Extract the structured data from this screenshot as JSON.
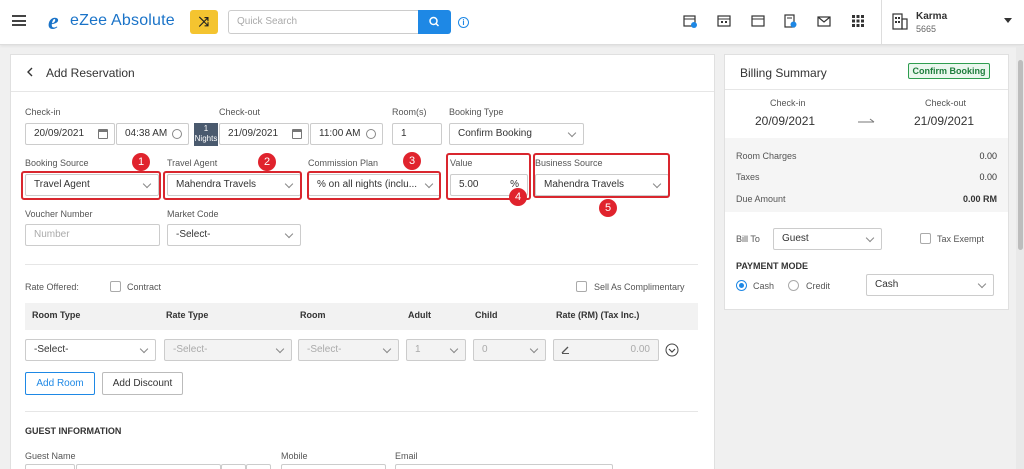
{
  "app": {
    "logo_e": "e",
    "logo_text": "eZee Absolute",
    "search_placeholder": "Quick Search",
    "user_name": "Karma",
    "user_code": "5665"
  },
  "page": {
    "title": "Add Reservation"
  },
  "form": {
    "checkin_label": "Check-in",
    "checkin_date": "20/09/2021",
    "checkin_time": "04:38 AM",
    "nights_value": "1",
    "nights_label": "Nights",
    "checkout_label": "Check-out",
    "checkout_date": "21/09/2021",
    "checkout_time": "11:00 AM",
    "rooms_label": "Room(s)",
    "rooms_value": "1",
    "booking_type_label": "Booking Type",
    "booking_type_value": "Confirm Booking",
    "booking_source_label": "Booking Source",
    "booking_source_value": "Travel Agent",
    "travel_agent_label": "Travel Agent",
    "travel_agent_value": "Mahendra Travels",
    "commission_plan_label": "Commission Plan",
    "commission_plan_value": "% on all nights (inclu...",
    "value_label": "Value",
    "value_value": "5.00",
    "value_unit": "%",
    "business_source_label": "Business Source",
    "business_source_value": "Mahendra Travels",
    "voucher_label": "Voucher Number",
    "voucher_placeholder": "Number",
    "market_code_label": "Market Code",
    "market_code_value": "-Select-"
  },
  "markers": [
    "1",
    "2",
    "3",
    "4",
    "5"
  ],
  "rates": {
    "rate_offered_label": "Rate Offered:",
    "contract_label": "Contract",
    "complimentary_label": "Sell As Complimentary",
    "headers": [
      "Room Type",
      "Rate Type",
      "Room",
      "Adult",
      "Child",
      "Rate (RM)  (Tax Inc.)"
    ],
    "row": {
      "room_type": "-Select-",
      "rate_type": "-Select-",
      "room": "-Select-",
      "adult": "1",
      "child": "0",
      "rate": "0.00"
    },
    "add_room": "Add Room",
    "add_discount": "Add Discount"
  },
  "guest": {
    "section_title": "GUEST INFORMATION",
    "name_label": "Guest Name",
    "mobile_label": "Mobile",
    "email_label": "Email"
  },
  "billing": {
    "title": "Billing Summary",
    "status_badge": "Confirm Booking",
    "checkin_label": "Check-in",
    "checkin_date": "20/09/2021",
    "checkout_label": "Check-out",
    "checkout_date": "21/09/2021",
    "room_charges_label": "Room Charges",
    "room_charges_value": "0.00",
    "taxes_label": "Taxes",
    "taxes_value": "0.00",
    "due_amount_label": "Due Amount",
    "due_amount_value": "0.00 RM",
    "bill_to_label": "Bill To",
    "bill_to_value": "Guest",
    "tax_exempt_label": "Tax Exempt",
    "payment_mode_label": "PAYMENT MODE",
    "cash_label": "Cash",
    "credit_label": "Credit",
    "payment_select": "Cash"
  },
  "colors": {
    "accent": "#1e88e5",
    "highlight": "#d9262e",
    "shuffle": "#f4c430",
    "badge_green": "#2e9d4f"
  }
}
